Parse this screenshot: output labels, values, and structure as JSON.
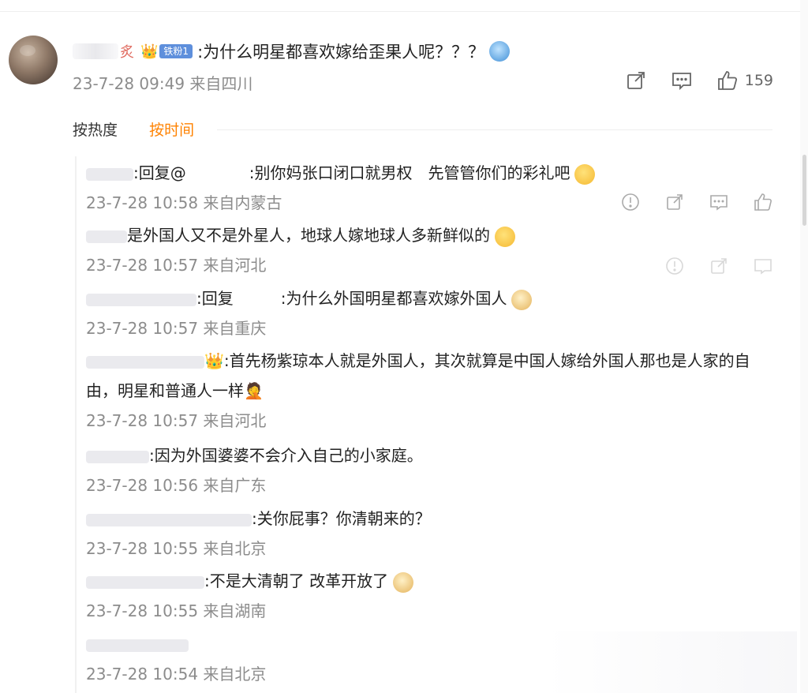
{
  "post": {
    "comment_text": ":为什么明星都喜欢嫁给歪果人呢？？？",
    "name_fragment": "炙",
    "badge": "铁粉1",
    "meta": "23-7-28 09:49 来自四川",
    "like_count": "159"
  },
  "sort": {
    "hot": "按热度",
    "time": "按时间",
    "active": "time"
  },
  "replies": [
    {
      "text": ":回复@　　　　:别你妈张口闭口就男权　先管管你们的彩礼吧",
      "meta": "23-7-28 10:58 来自内蒙古"
    },
    {
      "text": "是外国人又不是外星人，地球人嫁地球人多新鲜似的",
      "meta": "23-7-28 10:57 来自河北"
    },
    {
      "text": ":回复　　　:为什么外国明星都喜欢嫁外国人",
      "meta": "23-7-28 10:57 来自重庆"
    },
    {
      "text": ":首先杨紫琼本人就是外国人，其次就算是中国人嫁给外国人那也是人家的自由，明星和普通人一样",
      "meta": "23-7-28 10:57 来自河北"
    },
    {
      "text": ":因为外国婆婆不会介入自己的小家庭。",
      "meta": "23-7-28 10:56 来自广东"
    },
    {
      "text": ":关你屁事？你清朝来的？",
      "meta": "23-7-28 10:55 来自北京"
    },
    {
      "text": ":不是大清朝了 改革开放了",
      "meta": "23-7-28 10:55 来自湖南"
    },
    {
      "text": "",
      "meta": "23-7-28 10:54 来自北京"
    }
  ],
  "colors": {
    "accent": "#ff8200",
    "meta_gray": "#8c8c8c",
    "badge_blue": "#5e8fdc"
  },
  "icons": {
    "share": "share-icon",
    "comment": "comment-icon",
    "like": "thumbs-up-icon",
    "report": "report-icon"
  }
}
